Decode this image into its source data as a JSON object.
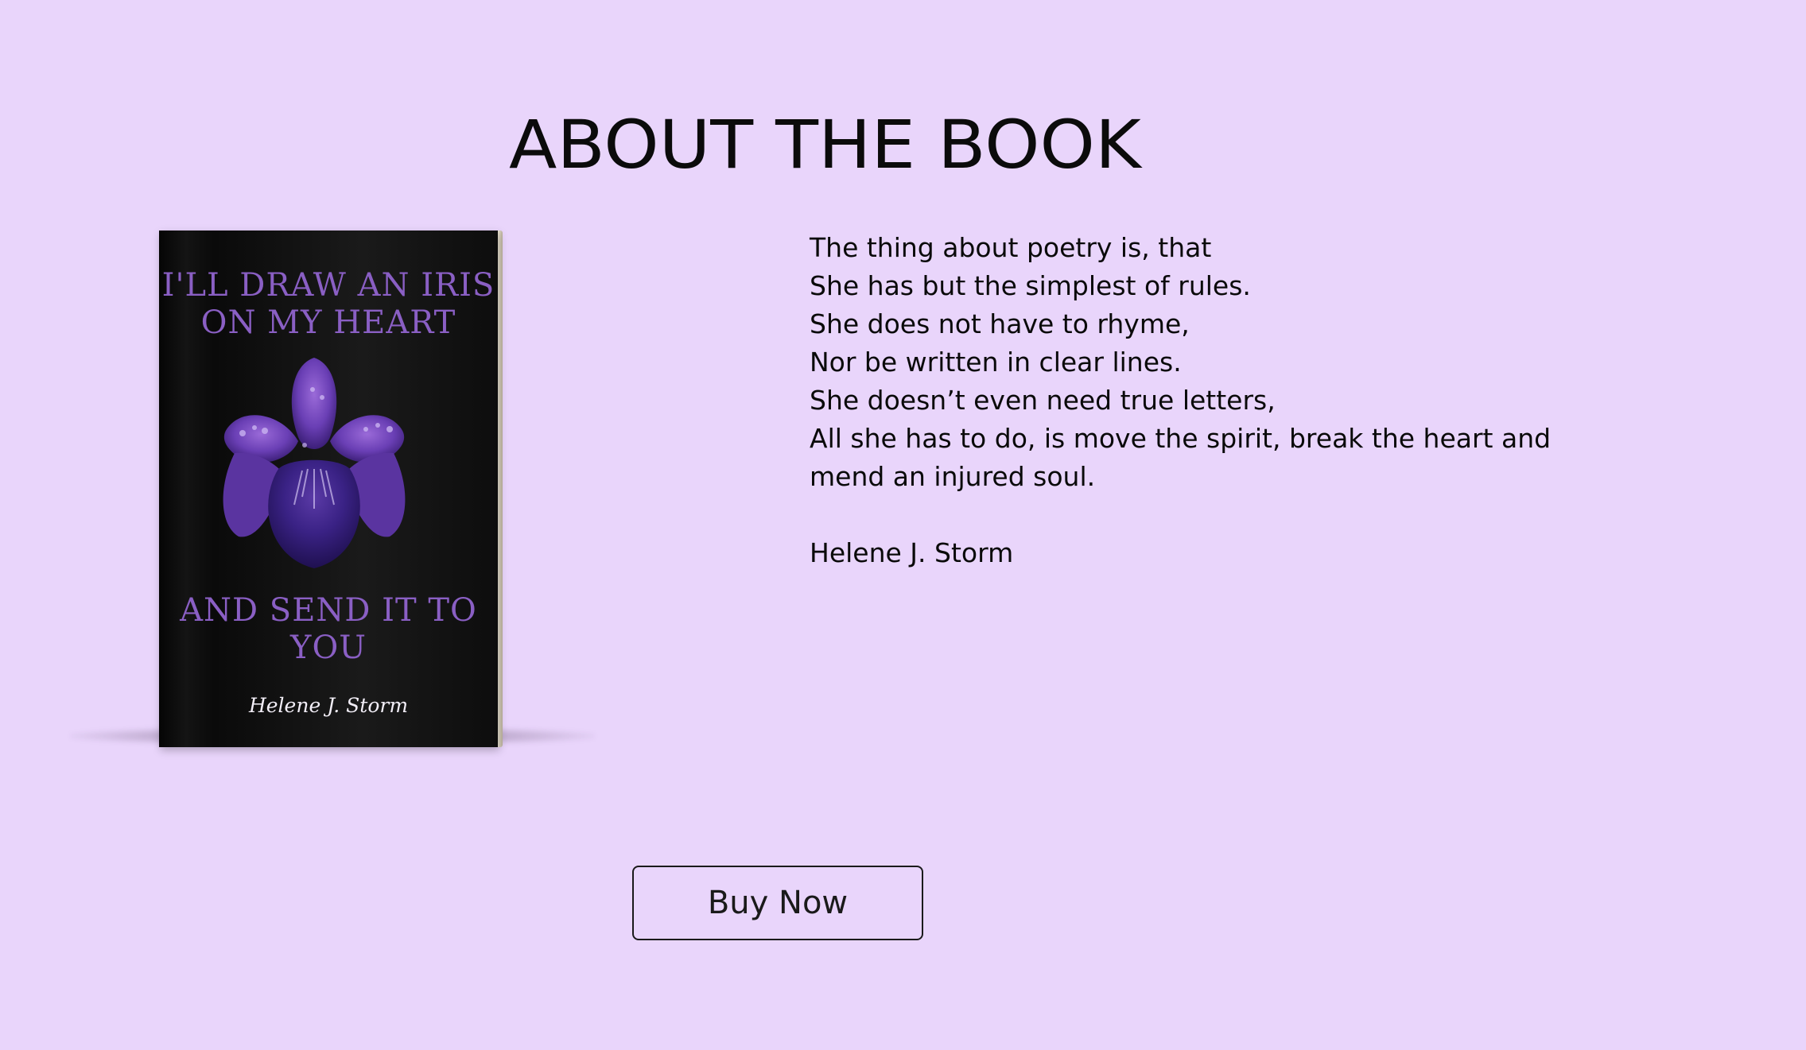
{
  "section": {
    "title": "ABOUT THE BOOK"
  },
  "book": {
    "cover_title_top": "I'LL DRAW AN IRIS ON MY HEART",
    "cover_title_top_line1": "I'LL DRAW AN IRIS",
    "cover_title_top_line2": "ON MY HEART",
    "cover_title_bottom_line1": "AND SEND IT TO",
    "cover_title_bottom_line2": "YOU",
    "cover_author": "Helene J. Storm",
    "cover_image": "iris-flower-image",
    "colors": {
      "cover_background": "#0a0a0a",
      "cover_title": "#8a5fc4",
      "iris_petal": "#6a3fb5"
    }
  },
  "poem": {
    "lines": [
      "The thing about poetry is, that",
      "She has but the simplest of rules.",
      "She does not have to rhyme,",
      "Nor be written in clear lines.",
      "She doesn’t even need true letters,",
      "All she has to do, is move the spirit, break the heart and",
      "mend an injured soul."
    ],
    "author": "Helene J. Storm"
  },
  "cta": {
    "buy_label": "Buy Now"
  },
  "colors": {
    "page_background": "#e9d5fb",
    "text": "#0a0a0a"
  }
}
